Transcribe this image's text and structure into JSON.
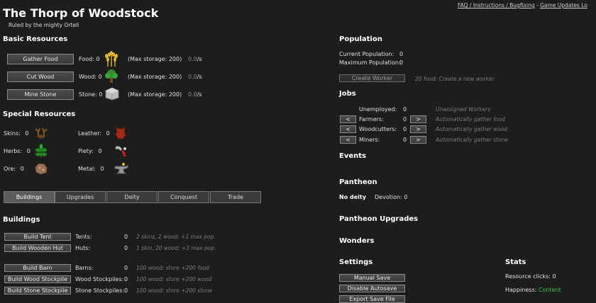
{
  "header": {
    "title": "The Thorp of Woodstock",
    "subtitle": "Ruled by the mighty Ortell",
    "links": {
      "faq": "FAQ / Instructions / Bugfixing",
      "sep": " - ",
      "updates": "Game Updates Lo"
    }
  },
  "basic": {
    "heading": "Basic Resources",
    "rows": [
      {
        "button": "Gather Food",
        "label": "Food:",
        "value": "0",
        "storage": "(Max storage: 200)",
        "rate": "0",
        "rate_unit": "/s"
      },
      {
        "button": "Cut Wood",
        "label": "Wood:",
        "value": "0",
        "storage": "(Max storage: 200)",
        "rate": "0",
        "rate_unit": "/s"
      },
      {
        "button": "Mine Stone",
        "label": "Stone:",
        "value": "0",
        "storage": "(Max storage: 200)",
        "rate": "0",
        "rate_unit": "/s"
      }
    ]
  },
  "special": {
    "heading": "Special Resources",
    "items": [
      {
        "label": "Skins:",
        "value": "0"
      },
      {
        "label": "Herbs:",
        "value": "0"
      },
      {
        "label": "Ore:",
        "value": "0"
      },
      {
        "label": "Leather:",
        "value": "0"
      },
      {
        "label": "Piety:",
        "value": "0"
      },
      {
        "label": "Metal:",
        "value": "0"
      }
    ]
  },
  "tabs": [
    "Buildings",
    "Upgrades",
    "Deity",
    "Conquest",
    "Trade"
  ],
  "buildings": {
    "heading": "Buildings",
    "rows": [
      {
        "button": "Build Tent",
        "label": "Tents:",
        "value": "0",
        "desc": "2 skins, 2 wood: +1 max pop."
      },
      {
        "button": "Build Wooden Hut",
        "label": "Huts:",
        "value": "0",
        "desc": "1 skin, 20 wood: +3 max pop."
      },
      {
        "button": "Build Barn",
        "label": "Barns:",
        "value": "0",
        "desc": "100 wood: store +200 food"
      },
      {
        "button": "Build Wood Stockpile",
        "label": "Wood Stockpiles:",
        "value": "0",
        "desc": "100 wood: store +200 wood"
      },
      {
        "button": "Build Stone Stockpile",
        "label": "Stone Stockpiles:",
        "value": "0",
        "desc": "100 wood: store +200 stone"
      }
    ]
  },
  "population": {
    "heading": "Population",
    "current_label": "Current Population:",
    "current_value": "0",
    "max_label": "Maximum Population:",
    "max_value": "0",
    "create_button": "Create Worker",
    "create_desc": "20 food: Create a new worker"
  },
  "jobs": {
    "heading": "Jobs",
    "unemployed": {
      "label": "Unemployed:",
      "value": "0",
      "desc": "Unassigned Workers"
    },
    "rows": [
      {
        "label": "Farmers:",
        "value": "0",
        "desc": "Automatically gather food"
      },
      {
        "label": "Woodcutters:",
        "value": "0",
        "desc": "Automatically gather wood"
      },
      {
        "label": "Miners:",
        "value": "0",
        "desc": "Automatically gather stone"
      }
    ],
    "minus": "<",
    "plus": ">"
  },
  "events": {
    "heading": "Events"
  },
  "pantheon": {
    "heading": "Pantheon",
    "deity": "No deity",
    "devotion_label": "Devotion:",
    "devotion_value": "0"
  },
  "pantheon_upgrades": {
    "heading": "Pantheon Upgrades"
  },
  "wonders": {
    "heading": "Wonders"
  },
  "settings": {
    "heading": "Settings",
    "buttons": [
      "Manual Save",
      "Disable Autosave",
      "Export Save File"
    ]
  },
  "stats": {
    "heading": "Stats",
    "clicks_label": "Resource clicks:",
    "clicks_value": "0",
    "happiness_label": "Happiness:",
    "happiness_value": "Content",
    "happiness_color": "#43c043"
  },
  "icons": {
    "food": "wheat-icon",
    "wood": "tree-icon",
    "stone": "stone-block-icon",
    "skins": "antlers-icon",
    "herbs": "herb-icon",
    "ore": "ore-rock-icon",
    "leather": "leather-hide-icon",
    "piety": "piety-chalice-icon",
    "metal": "anvil-icon"
  }
}
